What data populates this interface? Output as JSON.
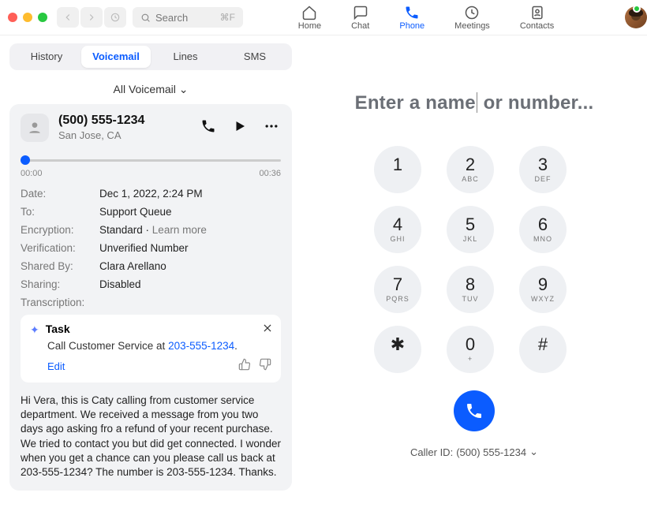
{
  "topbar": {
    "search_placeholder": "Search",
    "search_kbd": "⌘F",
    "tabs": [
      {
        "label": "Home",
        "icon": "home"
      },
      {
        "label": "Chat",
        "icon": "chat"
      },
      {
        "label": "Phone",
        "icon": "phone"
      },
      {
        "label": "Meetings",
        "icon": "clock"
      },
      {
        "label": "Contacts",
        "icon": "contacts"
      }
    ],
    "active_tab": "Phone"
  },
  "sidebar": {
    "segments": [
      "History",
      "Voicemail",
      "Lines",
      "SMS"
    ],
    "active_segment": "Voicemail",
    "dropdown_label": "All Voicemail"
  },
  "voicemail": {
    "phone": "(500) 555-1234",
    "location": "San Jose, CA",
    "progress": {
      "current": "00:00",
      "total": "00:36"
    },
    "meta": {
      "date_label": "Date:",
      "date_val": "Dec 1, 2022, 2:24 PM",
      "to_label": "To:",
      "to_val": "Support Queue",
      "enc_label": "Encryption:",
      "enc_val": "Standard",
      "enc_link": "Learn more",
      "ver_label": "Verification:",
      "ver_val": "Unverified Number",
      "shared_label": "Shared By:",
      "shared_val": "Clara Arellano",
      "sharing_label": "Sharing:",
      "sharing_val": "Disabled",
      "trans_label": "Transcription:"
    },
    "task": {
      "title": "Task",
      "body_pre": "Call Customer Service at ",
      "body_link": "203-555-1234",
      "body_post": ".",
      "edit": "Edit"
    },
    "transcript": "Hi Vera, this is Caty calling from customer service department. We received a message from you two days ago asking fro a refund of your recent purchase. We tried to contact you but did get connected. I wonder when you get a chance can you please call us back at 203-555-1234? The number is 203-555-1234. Thanks."
  },
  "dialer": {
    "placeholder": "Enter a name or number...",
    "keys": [
      {
        "n": "1",
        "s": ""
      },
      {
        "n": "2",
        "s": "ABC"
      },
      {
        "n": "3",
        "s": "DEF"
      },
      {
        "n": "4",
        "s": "GHI"
      },
      {
        "n": "5",
        "s": "JKL"
      },
      {
        "n": "6",
        "s": "MNO"
      },
      {
        "n": "7",
        "s": "PQRS"
      },
      {
        "n": "8",
        "s": "TUV"
      },
      {
        "n": "9",
        "s": "WXYZ"
      },
      {
        "n": "✱",
        "s": ""
      },
      {
        "n": "0",
        "s": "+"
      },
      {
        "n": "#",
        "s": ""
      }
    ],
    "caller_id_label": "Caller ID: ",
    "caller_id_value": "(500) 555-1234"
  }
}
